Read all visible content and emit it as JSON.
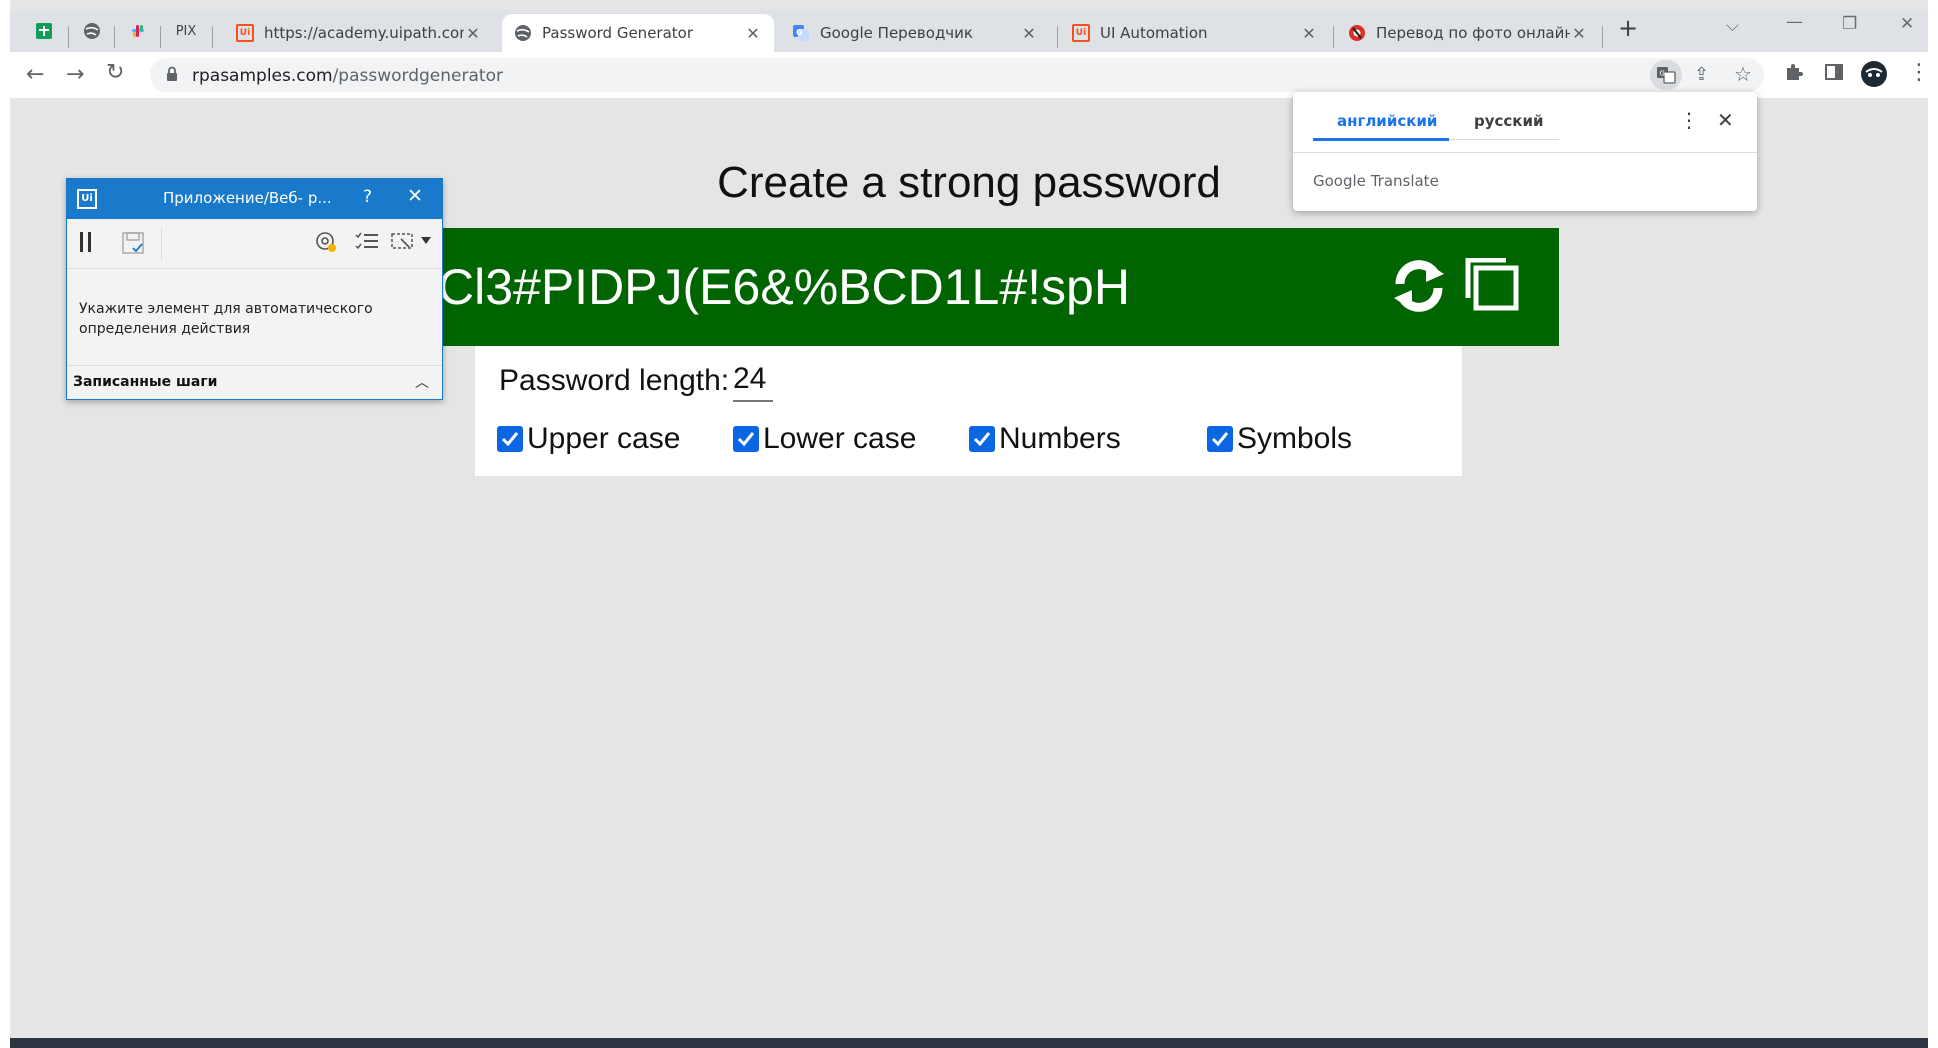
{
  "browser": {
    "pinned_tabs": [
      {
        "icon": "sheets-icon"
      },
      {
        "icon": "globe-icon"
      },
      {
        "icon": "slack-icon"
      },
      {
        "label": "PIX"
      }
    ],
    "tabs": [
      {
        "title": "https://academy.uipath.com/p",
        "icon": "uipath-icon",
        "icon_color": "#f4511e"
      },
      {
        "title": "Password Generator",
        "icon": "globe-icon",
        "active": true
      },
      {
        "title": "Google Переводчик",
        "icon": "google-translate-icon",
        "icon_color": "#4285f4"
      },
      {
        "title": "UI Automation",
        "icon": "uipath-icon",
        "icon_color": "#f4511e"
      },
      {
        "title": "Перевод по фото онлайн с а",
        "icon": "photo-translate-icon",
        "icon_color": "#d93025"
      }
    ],
    "url": {
      "host": "rpasamples.com",
      "path": "/passwordgenerator"
    }
  },
  "page": {
    "heading": "Create a strong password",
    "password": "Cl3#PIDPJ(E6&%BCD1L#!spH",
    "length_label": "Password length:",
    "length_value": "24",
    "options": [
      {
        "label": "Upper case",
        "checked": true
      },
      {
        "label": "Lower case",
        "checked": true
      },
      {
        "label": "Numbers",
        "checked": true
      },
      {
        "label": "Symbols",
        "checked": true
      }
    ],
    "bar_color": "#006400"
  },
  "translate_popup": {
    "lang_source": "английский",
    "lang_target": "русский",
    "brand": "Google",
    "product": "Translate"
  },
  "recorder": {
    "title": "Приложение/Веб- р...",
    "logo": "Ui",
    "help": "?",
    "message": "Укажите элемент для автоматического определения действия",
    "footer": "Записанные шаги",
    "accent": "#1979ca"
  }
}
